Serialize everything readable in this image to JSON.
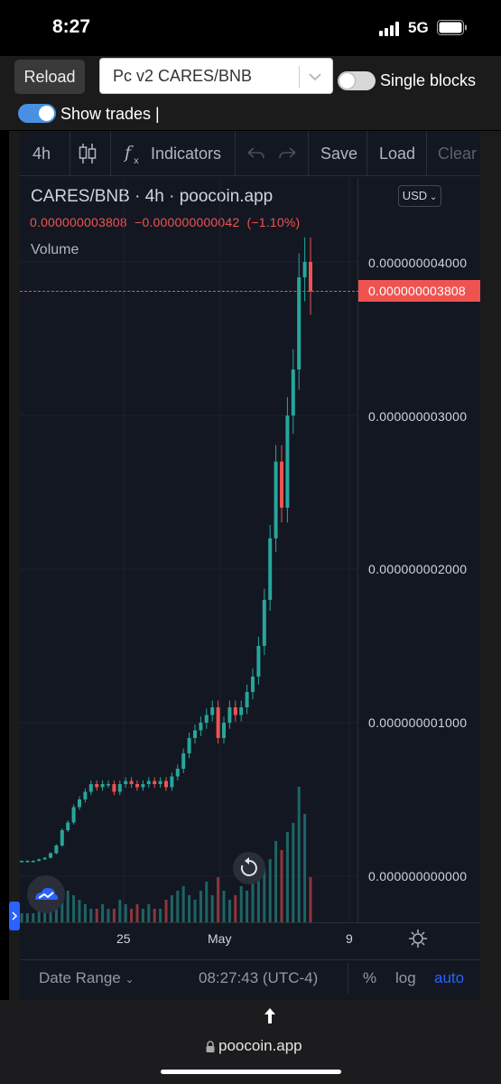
{
  "status_bar": {
    "time": "8:27",
    "network": "5G"
  },
  "controls": {
    "reload_label": "Reload",
    "pair_select_value": "Pc v2 CARES/BNB",
    "single_blocks_label": "Single blocks",
    "single_blocks_on": false,
    "show_trades_label": "Show trades |",
    "show_trades_on": true
  },
  "toolbar": {
    "interval": "4h",
    "indicators_label": "Indicators",
    "save_label": "Save",
    "load_label": "Load",
    "clear_label": "Clear"
  },
  "legend": {
    "title": "CARES/BNB · 4h · poocoin.app",
    "price_line": "0.000000003808  −0.000000000042  (−1.10%)",
    "volume_label": "Volume",
    "currency": "USD"
  },
  "current_price_label": "0.000000003808",
  "colors": {
    "up": "#26a69a",
    "down": "#ef5350",
    "background": "#131722",
    "accent": "#2962ff"
  },
  "bottom_bar": {
    "date_range_label": "Date Range",
    "time_label": "08:27:43 (UTC-4)",
    "percent_label": "%",
    "log_label": "log",
    "auto_label": "auto"
  },
  "browser": {
    "url": "poocoin.app"
  },
  "chart_data": {
    "type": "candlestick",
    "title": "CARES/BNB · 4h · poocoin.app",
    "y_ticks": [
      "0.000000004000",
      "0.000000003000",
      "0.000000002000",
      "0.000000001000",
      "0.000000000000"
    ],
    "x_ticks": [
      "25",
      "May",
      "9"
    ],
    "ylim": [
      0,
      4.1e-09
    ],
    "current_price": 3.808e-09,
    "series": [
      {
        "name": "price",
        "close": [
          1e-10,
          1e-10,
          1e-10,
          1.1e-10,
          1.2e-10,
          1.5e-10,
          2e-10,
          3e-10,
          3.5e-10,
          4.5e-10,
          5e-10,
          5.5e-10,
          6e-10,
          5.8e-10,
          6e-10,
          6e-10,
          5.5e-10,
          6e-10,
          6.2e-10,
          6e-10,
          5.8e-10,
          6e-10,
          6.2e-10,
          6e-10,
          6.2e-10,
          5.8e-10,
          6.5e-10,
          7e-10,
          8e-10,
          9e-10,
          9.5e-10,
          1e-09,
          1.05e-09,
          1.1e-09,
          9e-10,
          1e-09,
          1.1e-09,
          1.05e-09,
          1.1e-09,
          1.2e-09,
          1.3e-09,
          1.5e-09,
          1.8e-09,
          2.2e-09,
          2.7e-09,
          2.4e-09,
          3e-09,
          3.3e-09,
          3.9e-09,
          4e-09,
          3.808e-09
        ]
      },
      {
        "name": "volume",
        "values": [
          2,
          2,
          2,
          3,
          3,
          4,
          5,
          6,
          7,
          6,
          5,
          4,
          3,
          3,
          4,
          3,
          3,
          5,
          4,
          3,
          4,
          3,
          4,
          3,
          3,
          5,
          6,
          7,
          8,
          6,
          5,
          7,
          9,
          6,
          10,
          7,
          5,
          6,
          8,
          7,
          9,
          10,
          12,
          14,
          18,
          16,
          20,
          22,
          30,
          24,
          10
        ]
      }
    ]
  }
}
